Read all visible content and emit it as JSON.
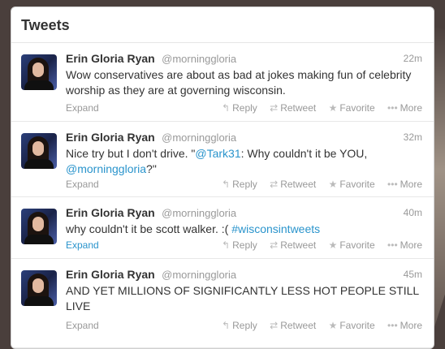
{
  "panel": {
    "title": "Tweets"
  },
  "actions": {
    "expand": "Expand",
    "reply": "Reply",
    "retweet": "Retweet",
    "favorite": "Favorite",
    "more": "More"
  },
  "icons": {
    "reply": "↰",
    "retweet": "⇄",
    "favorite": "★",
    "more": "•••"
  },
  "tweets": [
    {
      "name": "Erin Gloria Ryan",
      "handle": "@morninggloria",
      "time": "22m",
      "text": "Wow conservatives are about as bad at jokes making fun of celebrity worship as they are at governing wisconsin."
    },
    {
      "name": "Erin Gloria Ryan",
      "handle": "@morninggloria",
      "time": "32m",
      "text_pre": "Nice try but I don't drive. \"",
      "mention1": "@Tark31",
      "text_mid": ": Why couldn't it be YOU, ",
      "mention2": "@morninggloria",
      "text_post": "?\""
    },
    {
      "name": "Erin Gloria Ryan",
      "handle": "@morninggloria",
      "time": "40m",
      "text_pre": "why couldn't it be scott walker. :( ",
      "hashtag": "#wisconsintweets"
    },
    {
      "name": "Erin Gloria Ryan",
      "handle": "@morninggloria",
      "time": "45m",
      "text": "AND YET MILLIONS OF SIGNIFICANTLY LESS HOT PEOPLE STILL LIVE"
    }
  ]
}
